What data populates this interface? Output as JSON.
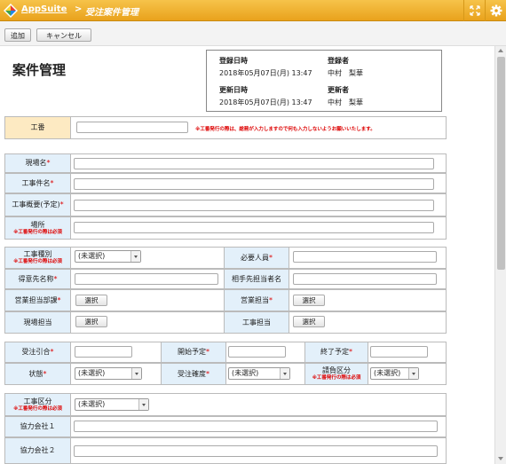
{
  "header": {
    "app_name": "AppSuite",
    "separator": ">",
    "breadcrumb": "受注案件管理"
  },
  "toolbar": {
    "add_label": "追加",
    "cancel_label": "キャンセル"
  },
  "page": {
    "title": "案件管理"
  },
  "record_info": {
    "created_label": "登録日時",
    "created_value": "2018年05月07日(月) 13:47",
    "creator_label": "登録者",
    "creator_value": "中村　梨華",
    "updated_label": "更新日時",
    "updated_value": "2018年05月07日(月) 13:47",
    "updater_label": "更新者",
    "updater_value": "中村　梨華"
  },
  "form": {
    "koban_label": "工番",
    "koban_warning": "※工番発行の際は、総務が入力しますので何も入力しないようお願いいたします。",
    "site_name_label": "現場名",
    "project_name_label": "工事件名",
    "overview_label": "工事概要(予定)",
    "location_label": "場所",
    "location_note": "※工番発行の際は必須",
    "work_type_label": "工事種別",
    "work_type_note": "※工番発行の際は必須",
    "required_staff_label": "必要人員",
    "client_label": "得意先名称",
    "contact_label": "相手先担当者名",
    "sales_dept_label": "営業担当部課",
    "sales_label": "営業担当",
    "site_mgr_label": "現場担当",
    "work_mgr_label": "工事担当",
    "order_price_label": "受注引合",
    "start_label": "開始予定",
    "end_label": "終了予定",
    "status_label": "状態",
    "accuracy_label": "受注確度",
    "contract_label": "請負区分",
    "contract_note": "※工番発行の際は必須",
    "class_label": "工事区分",
    "class_note": "※工番発行の際は必須",
    "partner1_label": "協力会社１",
    "partner2_label": "協力会社２",
    "required_mark": "*",
    "select_button": "選択",
    "select_default": "(未選択)"
  },
  "colors": {
    "header_bg": "#f0b22f",
    "label_bg": "#e3f0fa",
    "koban_bg": "#fdeac2",
    "required": "#dd0000"
  }
}
